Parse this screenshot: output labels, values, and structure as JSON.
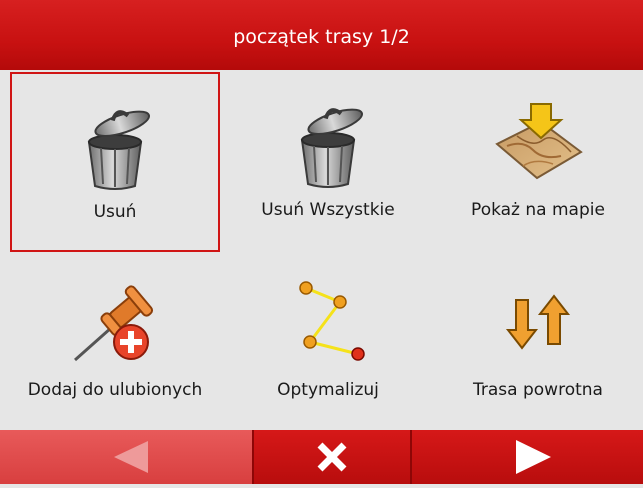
{
  "header": {
    "title": "początek trasy 1/2"
  },
  "tiles": [
    {
      "label": "Usuń",
      "icon": "trash-can-icon",
      "selected": true
    },
    {
      "label": "Usuń Wszystkie",
      "icon": "trash-can-icon"
    },
    {
      "label": "Pokaż na mapie",
      "icon": "map-arrow-icon"
    },
    {
      "label": "Dodaj do ulubionych",
      "icon": "pushpin-add-icon"
    },
    {
      "label": "Optymalizuj",
      "icon": "route-optimize-icon"
    },
    {
      "label": "Trasa powrotna",
      "icon": "reverse-arrows-icon"
    }
  ],
  "footer": {
    "back_icon": "arrow-left-icon",
    "close_icon": "close-icon",
    "next_icon": "arrow-right-icon"
  },
  "colors": {
    "header": "#c81111",
    "background": "#e6e6e6",
    "selection": "#d01515"
  }
}
